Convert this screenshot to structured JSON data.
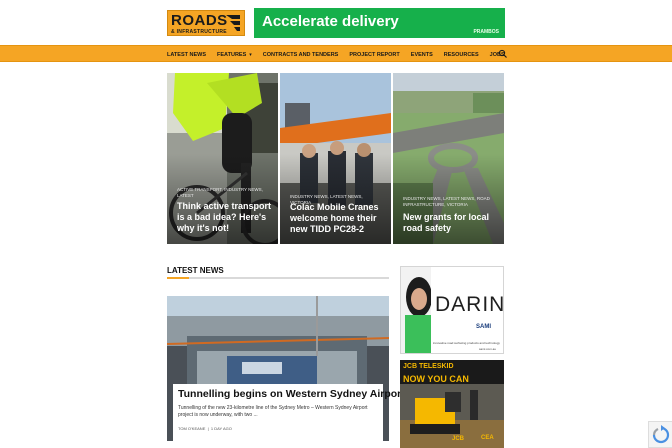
{
  "header": {
    "logo_main": "ROADS",
    "logo_sub": "& INFRASTRUCTURE",
    "banner_text": "Accelerate delivery",
    "banner_brand": "PRAMBOS"
  },
  "nav": {
    "items": [
      {
        "label": "LATEST NEWS"
      },
      {
        "label": "FEATURES",
        "has_dropdown": true
      },
      {
        "label": "CONTRACTS AND TENDERS"
      },
      {
        "label": "PROJECT REPORT"
      },
      {
        "label": "EVENTS"
      },
      {
        "label": "RESOURCES"
      },
      {
        "label": "JOBS"
      }
    ],
    "search_icon": "search-icon",
    "dropdown_icon": "chevron-down-icon"
  },
  "features": [
    {
      "categories": "ACTIVE TRANSPORT, INDUSTRY NEWS, LATEST",
      "title": "Think active transport is a bad idea? Here's why it's not!"
    },
    {
      "categories": "INDUSTRY NEWS, LATEST NEWS, VICTORIA",
      "title": "Colac Mobile Cranes welcome home their new TIDD PC28-2"
    },
    {
      "categories": "INDUSTRY NEWS, LATEST NEWS, ROAD INFRASTRUCTURE, VICTORIA",
      "title": "New grants for local road safety"
    }
  ],
  "latest": {
    "section_title": "LATEST NEWS",
    "title": "Tunnelling begins on Western Sydney Airport",
    "excerpt": "Tunnelling of the new 23-kilometre line of the Sydney Metro – Western Sydney Airport project is now underway, with two ...",
    "author": "TOM O'KEANE",
    "time": "1 DAY AGO"
  },
  "ads": {
    "ad1": {
      "headline": "DARING",
      "brand": "SAMI",
      "tagline": "innovative road surfacing products and technology",
      "url": "sami.com.au"
    },
    "ad2": {
      "logo": "JCB TELESKID",
      "headline": "NOW YOU CAN",
      "brand": "JCB",
      "dealer": "CEA"
    }
  },
  "colors": {
    "brand_orange": "#f5a524",
    "banner_green": "#16b04b",
    "jcb_yellow": "#f5b800"
  }
}
